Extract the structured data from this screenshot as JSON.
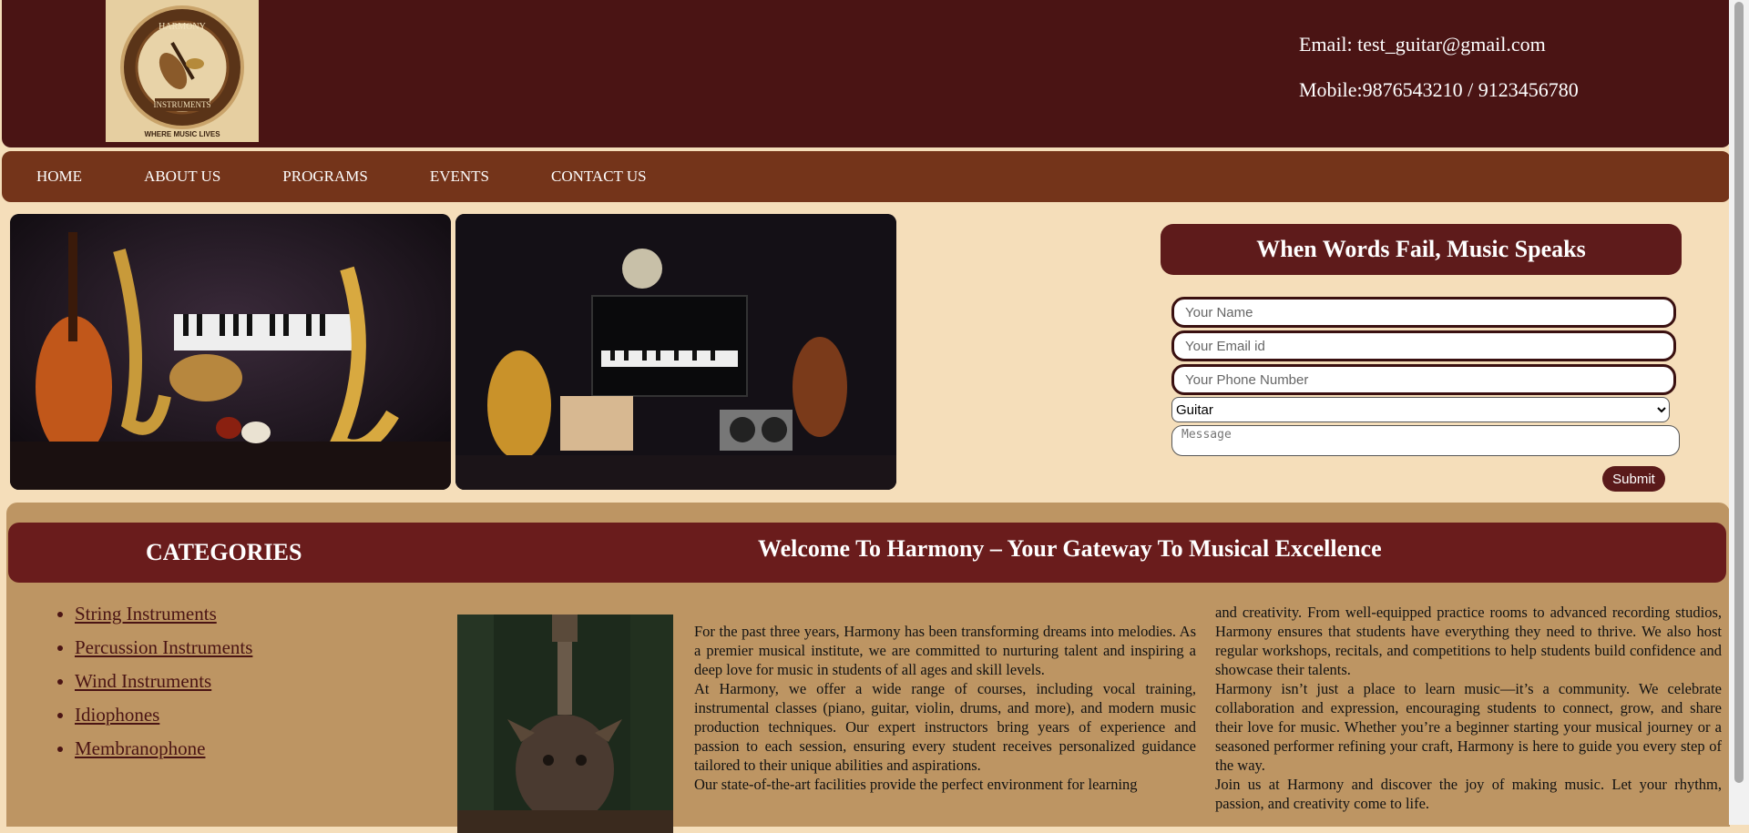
{
  "header": {
    "logo": {
      "alt": "Harmony Instruments logo",
      "text_top": "HARMONY",
      "text_mid": "INSTRUMENTS",
      "text_bottom": "WHERE MUSIC LIVES"
    },
    "email": "Email: test_guitar@gmail.com",
    "mobile": "Mobile:9876543210 / 9123456780"
  },
  "nav": {
    "items": [
      {
        "label": "HOME"
      },
      {
        "label": "ABOUT US"
      },
      {
        "label": "PROGRAMS"
      },
      {
        "label": "EVENTS"
      },
      {
        "label": "CONTACT US"
      }
    ]
  },
  "form": {
    "title": "When Words Fail, Music Speaks",
    "name_placeholder": "Your Name",
    "email_placeholder": "Your Email id",
    "phone_placeholder": "Your Phone Number",
    "instrument_selected": "Guitar",
    "message_placeholder": "Message",
    "submit_label": "Submit"
  },
  "categories": {
    "title": "CATEGORIES",
    "items": [
      "String Instruments",
      "Percussion Instruments",
      "Wind Instruments",
      "Idiophones",
      "Membranophone"
    ]
  },
  "welcome": {
    "title": "Welcome To Harmony – Your Gateway To Musical Excellence",
    "col1": [
      "For the past three years, Harmony has been transforming dreams into melodies. As a premier musical institute, we are committed to nurturing talent and inspiring a deep love for music in students of all ages and skill levels.",
      "At Harmony, we offer a wide range of courses, including vocal training, instrumental classes (piano, guitar, violin, drums, and more), and modern music production techniques. Our expert instructors bring years of experience and passion to each session, ensuring every student receives personalized guidance tailored to their unique abilities and aspirations.",
      "Our state-of-the-art facilities provide the perfect environment for learning"
    ],
    "col2": [
      "and creativity. From well-equipped practice rooms to advanced recording studios, Harmony ensures that students have everything they need to thrive. We also host regular workshops, recitals, and competitions to help students build confidence and showcase their talents.",
      "Harmony isn’t just a place to learn music—it’s a community. We celebrate collaboration and expression, encouraging students to connect, grow, and share their love for music. Whether you’re a beginner starting your musical journey or a seasoned performer refining your craft, Harmony is here to guide you every step of the way.",
      "Join us at Harmony and discover the joy of making music. Let your rhythm, passion, and creativity come to life."
    ]
  }
}
